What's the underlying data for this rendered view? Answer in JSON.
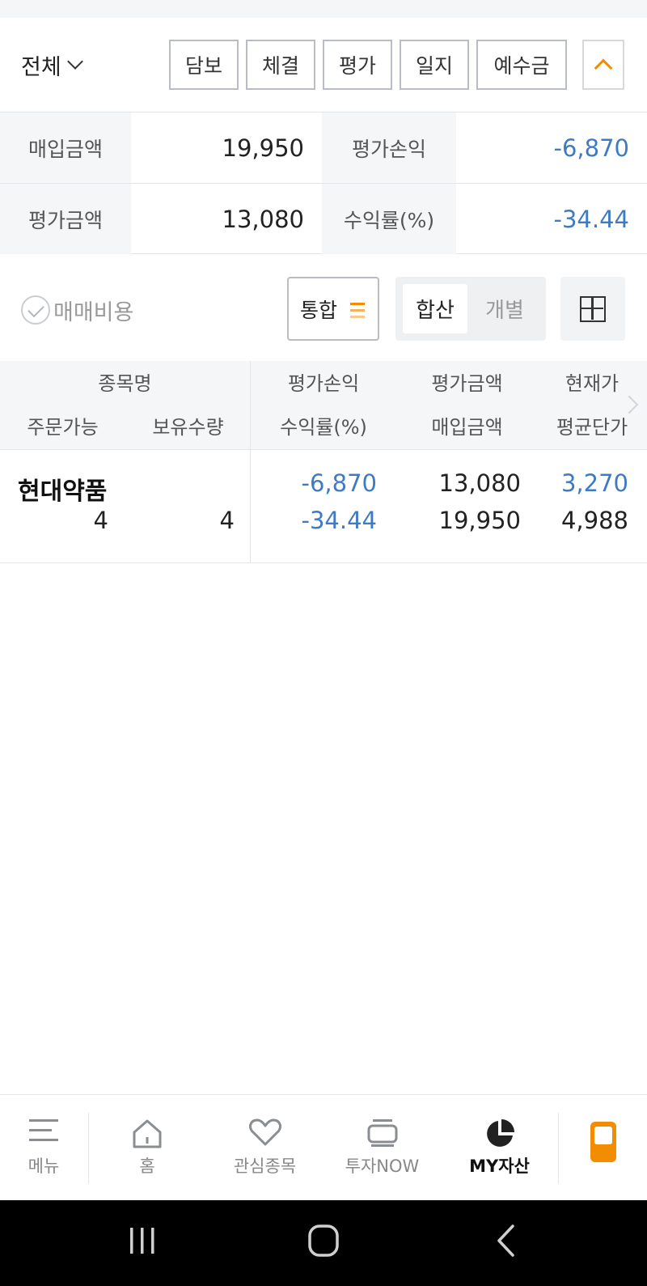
{
  "filter": {
    "account_select": "전체",
    "tabs": [
      "담보",
      "체결",
      "평가",
      "일지",
      "예수금"
    ]
  },
  "summary": {
    "purchase_label": "매입금액",
    "purchase_value": "19,950",
    "eval_pl_label": "평가손익",
    "eval_pl_value": "-6,870",
    "eval_amount_label": "평가금액",
    "eval_amount_value": "13,080",
    "return_label": "수익률(%)",
    "return_value": "-34.44"
  },
  "options": {
    "fee_label": "매매비용",
    "merge_label": "통합",
    "segment_on": "합산",
    "segment_off": "개별"
  },
  "holdings_header": {
    "name": "종목명",
    "orderable": "주문가능",
    "quantity": "보유수량",
    "eval_pl": "평가손익",
    "return_rate": "수익률(%)",
    "eval_amount": "평가금액",
    "purchase_amount": "매입금액",
    "current_price": "현재가",
    "avg_price": "평균단가"
  },
  "holdings": [
    {
      "name": "현대약품",
      "orderable": "4",
      "quantity": "4",
      "eval_pl": "-6,870",
      "return_rate": "-34.44",
      "eval_amount": "13,080",
      "purchase_amount": "19,950",
      "current_price": "3,270",
      "avg_price": "4,988"
    }
  ],
  "bottom_nav": {
    "menu": "메뉴",
    "home": "홈",
    "watchlist": "관심종목",
    "invest_now": "투자NOW",
    "my_assets": "MY자산"
  },
  "colors": {
    "accent": "#f28c00",
    "negative": "#3f7ac4"
  },
  "icons": [
    "chevron-down-icon",
    "chevron-up-icon",
    "check-circle-icon",
    "list-lines-icon",
    "plus-box-icon",
    "chevron-right-icon",
    "hamburger-icon",
    "home-icon",
    "heart-icon",
    "tv-icon",
    "pie-chart-icon",
    "phone-icon",
    "recent-apps-icon",
    "home-circle-icon",
    "back-icon"
  ]
}
